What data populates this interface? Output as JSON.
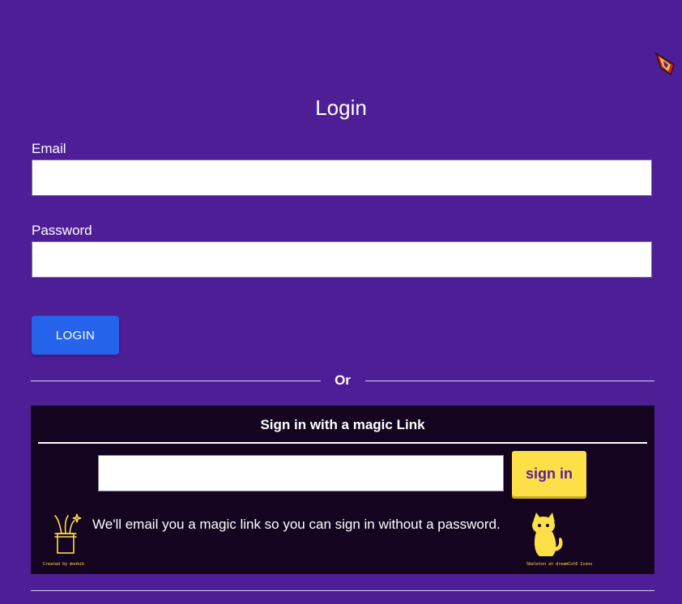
{
  "page": {
    "title": "Login",
    "background_color": "#4e1e96"
  },
  "form": {
    "email_label": "Email",
    "email_value": "",
    "password_label": "Password",
    "password_value": "",
    "login_button": "LOGIN",
    "login_button_color": "#2563eb"
  },
  "divider": {
    "text": "Or"
  },
  "magic_link": {
    "title": "Sign in with a magic Link",
    "email_value": "",
    "button_label": "sign in",
    "button_color": "#fde047",
    "description": "We'll email you a magic link so you can sign in without a password.",
    "left_credit": "Created by monkik",
    "right_credit": "Skeleton at dreamCut6 Icons",
    "left_icon": "magic-hat-icon",
    "right_icon": "cat-icon"
  },
  "corner": {
    "icon": "extension-icon"
  }
}
